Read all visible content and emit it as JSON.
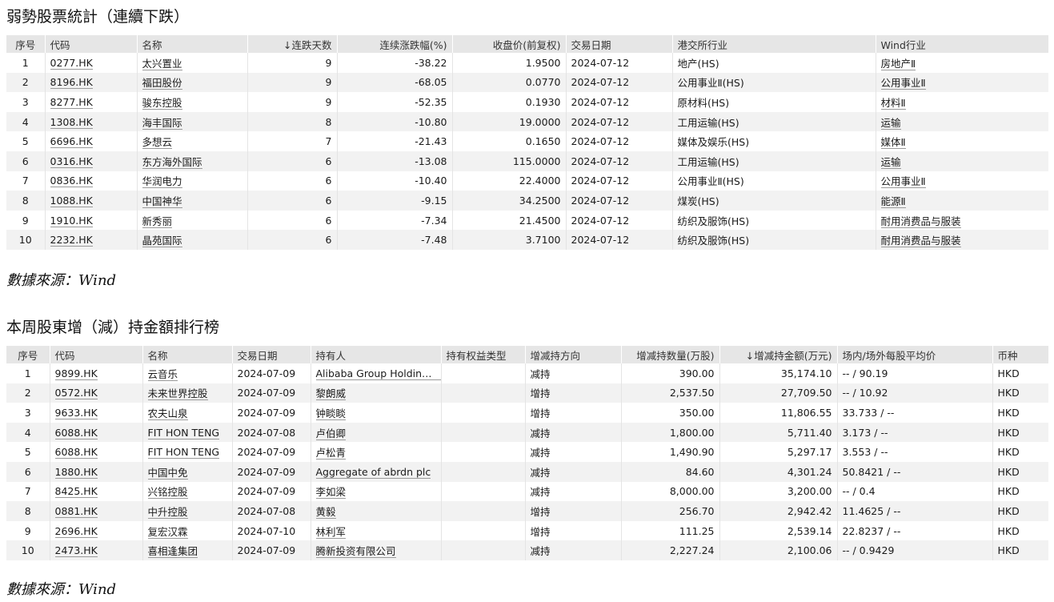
{
  "section1": {
    "title": "弱勢股票統計（連續下跌）",
    "headers": [
      "序号",
      "代码",
      "名称",
      "↓连跌天数",
      "连续涨跌幅(%)",
      "收盘价(前复权)",
      "交易日期",
      "港交所行业",
      "Wind行业"
    ],
    "rows": [
      [
        "1",
        "0277.HK",
        "太兴置业",
        "9",
        "-38.22",
        "1.9500",
        "2024-07-12",
        "地产(HS)",
        "房地产Ⅱ"
      ],
      [
        "2",
        "8196.HK",
        "福田股份",
        "9",
        "-68.05",
        "0.0770",
        "2024-07-12",
        "公用事业Ⅱ(HS)",
        "公用事业Ⅱ"
      ],
      [
        "3",
        "8277.HK",
        "骏东控股",
        "9",
        "-52.35",
        "0.1930",
        "2024-07-12",
        "原材料(HS)",
        "材料Ⅱ"
      ],
      [
        "4",
        "1308.HK",
        "海丰国际",
        "8",
        "-10.80",
        "19.0000",
        "2024-07-12",
        "工用运输(HS)",
        "运输"
      ],
      [
        "5",
        "6696.HK",
        "多想云",
        "7",
        "-21.43",
        "0.1650",
        "2024-07-12",
        "媒体及娱乐(HS)",
        "媒体Ⅱ"
      ],
      [
        "6",
        "0316.HK",
        "东方海外国际",
        "6",
        "-13.08",
        "115.0000",
        "2024-07-12",
        "工用运输(HS)",
        "运输"
      ],
      [
        "7",
        "0836.HK",
        "华润电力",
        "6",
        "-10.40",
        "22.4000",
        "2024-07-12",
        "公用事业Ⅱ(HS)",
        "公用事业Ⅱ"
      ],
      [
        "8",
        "1088.HK",
        "中国神华",
        "6",
        "-9.15",
        "34.2500",
        "2024-07-12",
        "煤炭(HS)",
        "能源Ⅱ"
      ],
      [
        "9",
        "1910.HK",
        "新秀丽",
        "6",
        "-7.34",
        "21.4500",
        "2024-07-12",
        "纺织及服饰(HS)",
        "耐用消费品与服装"
      ],
      [
        "10",
        "2232.HK",
        "晶苑国际",
        "6",
        "-7.48",
        "3.7100",
        "2024-07-12",
        "纺织及服饰(HS)",
        "耐用消费品与服装"
      ]
    ],
    "source": "數據來源：Wind"
  },
  "section2": {
    "title": "本周股東增（減）持金額排行榜",
    "headers": [
      "序号",
      "代码",
      "名称",
      "交易日期",
      "持有人",
      "持有权益类型",
      "增减持方向",
      "增减持数量(万股)",
      "↓增减持金额(万元)",
      "场内/场外每股平均价",
      "币种"
    ],
    "rows": [
      [
        "1",
        "9899.HK",
        "云音乐",
        "2024-07-09",
        "Alibaba Group Holding Limited",
        "",
        "减持",
        "390.00",
        "35,174.10",
        "-- / 90.19",
        "HKD"
      ],
      [
        "2",
        "0572.HK",
        "未来世界控股",
        "2024-07-09",
        "黎朗威",
        "",
        "增持",
        "2,537.50",
        "27,709.50",
        "-- / 10.92",
        "HKD"
      ],
      [
        "3",
        "9633.HK",
        "农夫山泉",
        "2024-07-09",
        "钟睒睒",
        "",
        "增持",
        "350.00",
        "11,806.55",
        "33.733 / --",
        "HKD"
      ],
      [
        "4",
        "6088.HK",
        "FIT HON TENG",
        "2024-07-08",
        "卢伯卿",
        "",
        "减持",
        "1,800.00",
        "5,711.40",
        "3.173 / --",
        "HKD"
      ],
      [
        "5",
        "6088.HK",
        "FIT HON TENG",
        "2024-07-09",
        "卢松青",
        "",
        "减持",
        "1,490.90",
        "5,297.17",
        "3.553 / --",
        "HKD"
      ],
      [
        "6",
        "1880.HK",
        "中国中免",
        "2024-07-09",
        "Aggregate of abrdn plc",
        "",
        "减持",
        "84.60",
        "4,301.24",
        "50.8421 / --",
        "HKD"
      ],
      [
        "7",
        "8425.HK",
        "兴铭控股",
        "2024-07-09",
        "李如梁",
        "",
        "减持",
        "8,000.00",
        "3,200.00",
        "-- / 0.4",
        "HKD"
      ],
      [
        "8",
        "0881.HK",
        "中升控股",
        "2024-07-08",
        "黄毅",
        "",
        "增持",
        "256.70",
        "2,942.42",
        "11.4625 / --",
        "HKD"
      ],
      [
        "9",
        "2696.HK",
        "复宏汉霖",
        "2024-07-10",
        "林利军",
        "",
        "增持",
        "111.25",
        "2,539.14",
        "22.8237 / --",
        "HKD"
      ],
      [
        "10",
        "2473.HK",
        "喜相逢集团",
        "2024-07-09",
        "腾新投资有限公司",
        "",
        "减持",
        "2,227.24",
        "2,100.06",
        "-- / 0.9429",
        "HKD"
      ]
    ],
    "source": "數據來源：Wind"
  }
}
